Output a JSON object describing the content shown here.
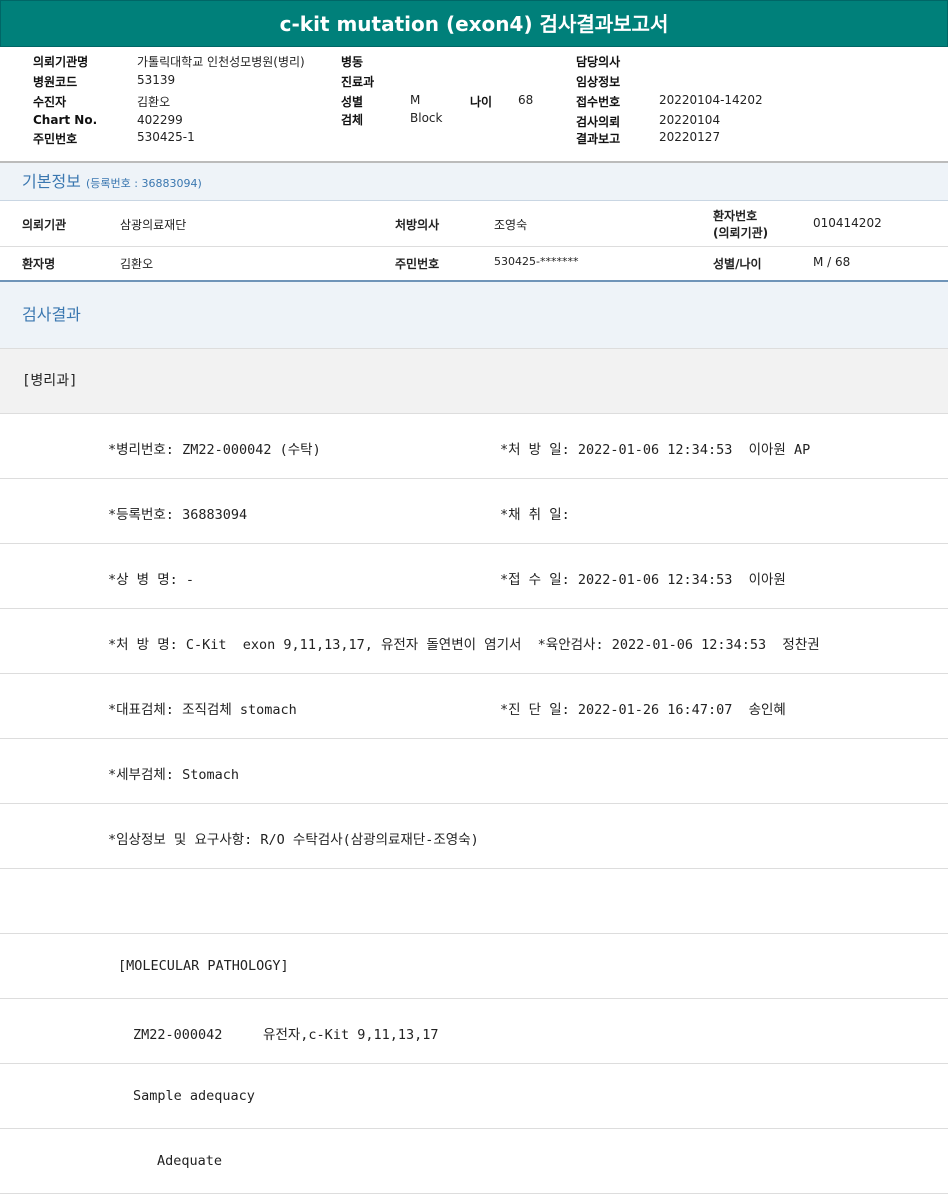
{
  "title": "c-kit mutation (exon4) 검사결과보고서",
  "info": {
    "c1": [
      [
        "의뢰기관명",
        "가톨릭대학교 인천성모병원(병리)"
      ],
      [
        "병원코드",
        "53139"
      ],
      [
        "수진자",
        "김환오"
      ],
      [
        "Chart No.",
        "402299"
      ],
      [
        "주민번호",
        "530425-1"
      ]
    ],
    "c2": [
      [
        "병동",
        ""
      ],
      [
        "진료과",
        ""
      ],
      [
        "성별",
        "M"
      ],
      [
        "검체",
        "Block"
      ]
    ],
    "age_label": "나이",
    "age": "68",
    "c3": [
      [
        "담당의사",
        ""
      ],
      [
        "임상정보",
        ""
      ],
      [
        "접수번호",
        "20220104-14202"
      ],
      [
        "검사의뢰",
        "20220104"
      ],
      [
        "결과보고",
        "20220127"
      ]
    ]
  },
  "basic": {
    "title": "기본정보",
    "reg": "(등록번호 : 36883094)",
    "r1": [
      "의뢰기관",
      "삼광의료재단",
      "처방의사",
      "조영숙",
      "환자번호",
      "(의뢰기관)",
      "010414202"
    ],
    "r2": [
      "환자명",
      "김환오",
      "주민번호",
      "530425-*******",
      "성별/나이",
      "M / 68"
    ]
  },
  "result_title": "검사결과",
  "dept": "[병리과]",
  "rows": [
    [
      "*병리번호: ZM22-000042 (수탁)",
      "*처 방 일: 2022-01-06 12:34:53  이아원 AP"
    ],
    [
      "*등록번호: 36883094",
      "*채 취 일:"
    ],
    [
      "*상 병 명: -",
      "*접 수 일: 2022-01-06 12:34:53  이아원"
    ],
    [
      "*처 방 명: C-Kit  exon 9,11,13,17, 유전자 돌연변이 염기서  *육안검사: 2022-01-06 12:34:53  정찬권",
      ""
    ],
    [
      "*대표검체: 조직검체 stomach",
      "*진 단 일: 2022-01-26 16:47:07  송인혜"
    ],
    [
      "*세부검체: Stomach",
      ""
    ],
    [
      "*임상정보 및 요구사항: R/O 수탁검사(삼광의료재단-조영숙)",
      ""
    ]
  ],
  "molecular": "[MOLECULAR PATHOLOGY]",
  "mol_line": "ZM22-000042     유전자,c-Kit 9,11,13,17",
  "adequacy_label": "Sample adequacy",
  "adequacy": "Adequate"
}
